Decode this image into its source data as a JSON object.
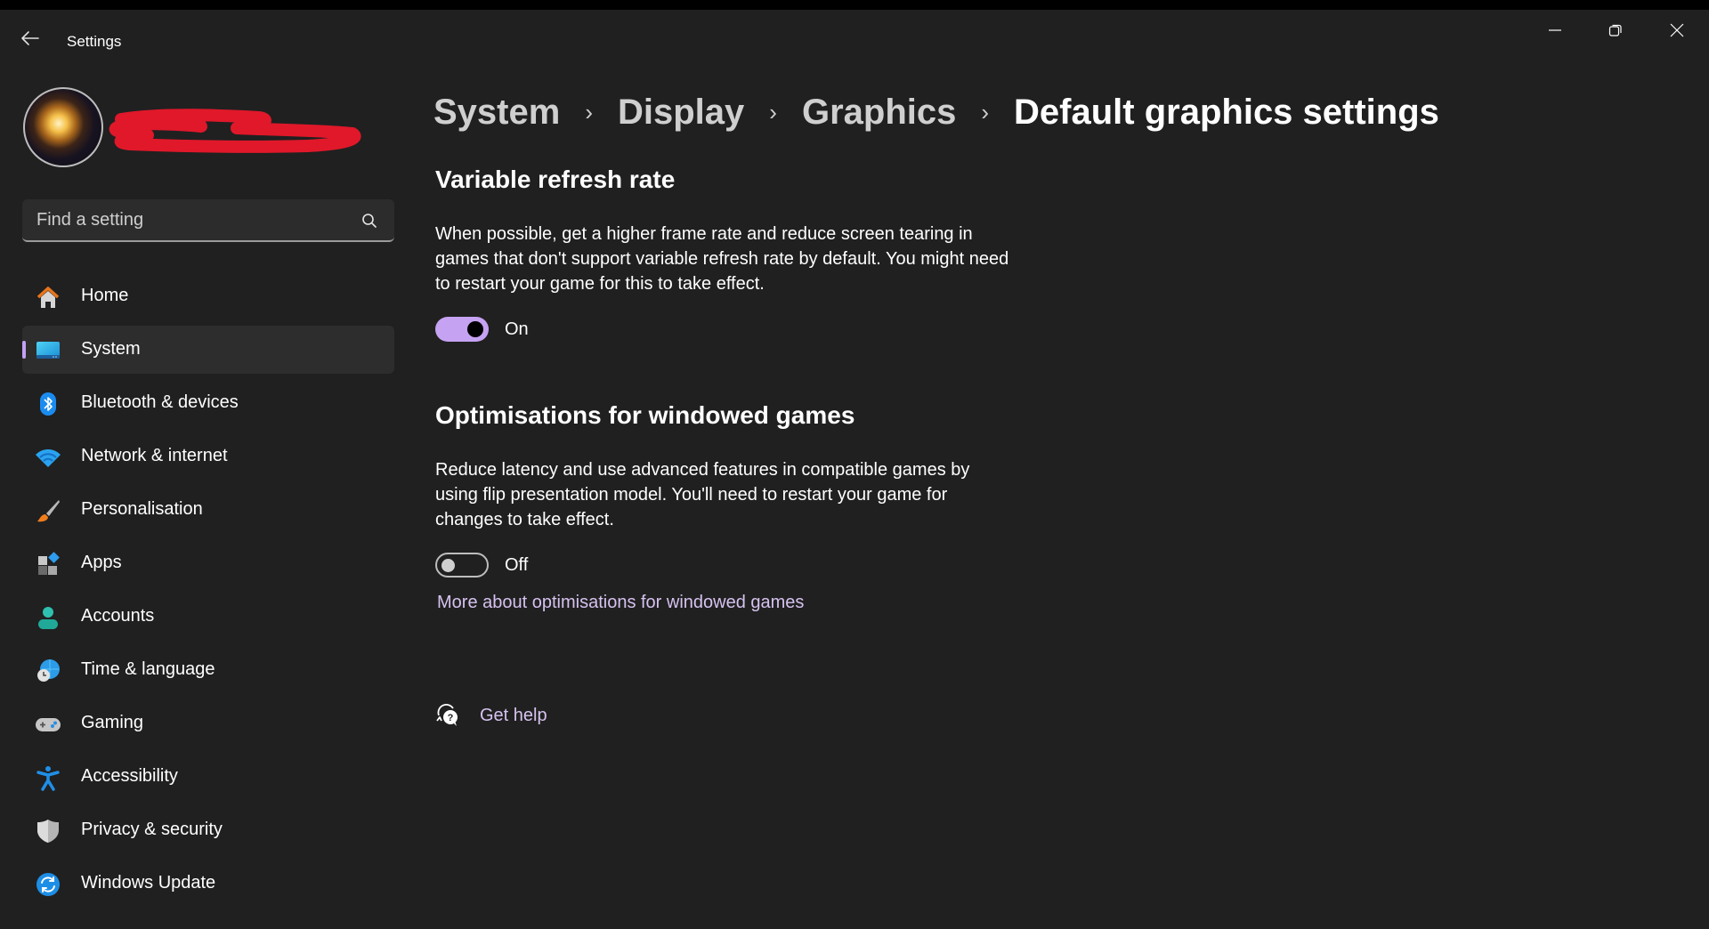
{
  "window": {
    "title": "Settings",
    "controls": [
      "minimize",
      "restore",
      "close"
    ]
  },
  "profile": {
    "name_redacted": true
  },
  "search": {
    "placeholder": "Find a setting",
    "value": ""
  },
  "sidebar": {
    "items": [
      {
        "label": "Home",
        "icon": "home-icon",
        "selected": false
      },
      {
        "label": "System",
        "icon": "system-monitor-icon",
        "selected": true
      },
      {
        "label": "Bluetooth & devices",
        "icon": "bluetooth-icon",
        "selected": false
      },
      {
        "label": "Network & internet",
        "icon": "wifi-icon",
        "selected": false
      },
      {
        "label": "Personalisation",
        "icon": "paintbrush-icon",
        "selected": false
      },
      {
        "label": "Apps",
        "icon": "apps-icon",
        "selected": false
      },
      {
        "label": "Accounts",
        "icon": "account-icon",
        "selected": false
      },
      {
        "label": "Time & language",
        "icon": "globe-clock-icon",
        "selected": false
      },
      {
        "label": "Gaming",
        "icon": "gamepad-icon",
        "selected": false
      },
      {
        "label": "Accessibility",
        "icon": "accessibility-icon",
        "selected": false
      },
      {
        "label": "Privacy & security",
        "icon": "shield-icon",
        "selected": false
      },
      {
        "label": "Windows Update",
        "icon": "windows-update-icon",
        "selected": false
      }
    ],
    "accent": "#c3a1f5"
  },
  "breadcrumb": {
    "items": [
      "System",
      "Display",
      "Graphics",
      "Default graphics settings"
    ],
    "separator": "›"
  },
  "sections": [
    {
      "title": "Variable refresh rate",
      "description": "When possible, get a higher frame rate and reduce screen tearing in games that don't support variable refresh rate by default. You might need to restart your game for this to take effect.",
      "toggle": {
        "state": true,
        "label": "On"
      }
    },
    {
      "title": "Optimisations for windowed games",
      "description": "Reduce latency and use advanced features in compatible games by using flip presentation model. You'll need to restart your game for changes to take effect.",
      "toggle": {
        "state": false,
        "label": "Off"
      },
      "link": "More about optimisations for windowed games"
    }
  ],
  "help": {
    "label": "Get help"
  },
  "colors": {
    "background": "#202020",
    "selected_bg": "#2d2d2d",
    "accent": "#c6a2f2",
    "link": "#d6c2f0"
  }
}
